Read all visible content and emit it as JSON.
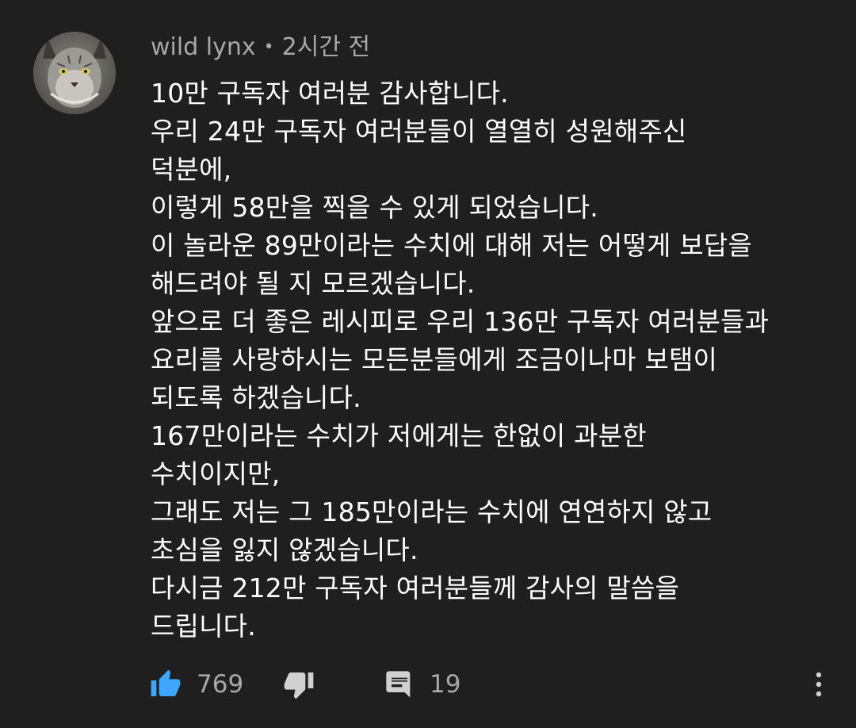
{
  "comment": {
    "author": "wild lynx",
    "separator": "•",
    "time": "2시간 전",
    "lines": [
      "10만 구독자 여러분 감사합니다.",
      "우리 24만 구독자 여러분들이 열열히 성원해주신",
      "덕분에,",
      "이렇게 58만을 찍을 수 있게 되었습니다.",
      "이 놀라운 89만이라는 수치에 대해 저는 어떻게 보답을",
      "해드려야 될 지 모르겠습니다.",
      "앞으로 더 좋은 레시피로 우리 136만 구독자 여러분들과",
      "요리를 사랑하시는 모든분들에게 조금이나마 보탬이",
      "되도록 하겠습니다.",
      "167만이라는 수치가 저에게는 한없이 과분한",
      "수치이지만,",
      "그래도 저는 그 185만이라는 수치에 연연하지 않고",
      "초심을 잃지 않겠습니다.",
      "다시금 212만 구독자 여러분들께 감사의 말씀을",
      "드립니다."
    ],
    "likes": "769",
    "replies": "19"
  },
  "icons": {
    "avatar": "lynx-avatar",
    "like": "thumbs-up-icon",
    "dislike": "thumbs-down-icon",
    "reply": "comment-icon",
    "more": "more-vertical-icon"
  },
  "colors": {
    "background": "#1f1f1f",
    "text": "#ffffff",
    "secondary_text": "#a8a8a8",
    "like_active": "#3ea6ff",
    "icon": "#d0d0d0"
  }
}
